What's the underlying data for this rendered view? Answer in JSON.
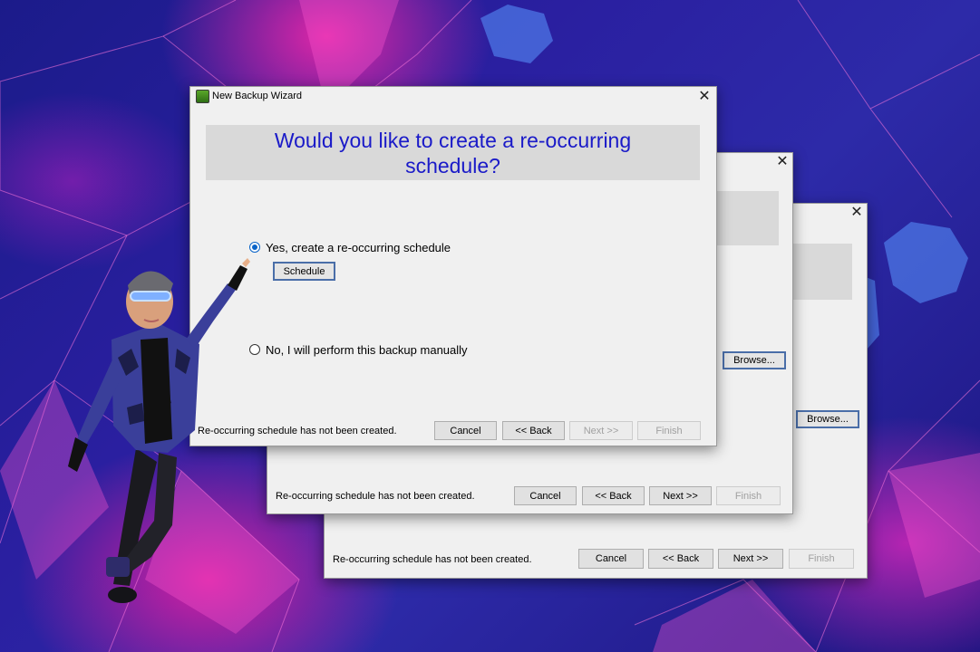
{
  "front": {
    "title": "New Backup Wizard",
    "icon": "backup-app-icon",
    "heading": "Would you like to create a re-occurring schedule?",
    "options": [
      {
        "label": "Yes, create a re-occurring schedule",
        "checked": true
      },
      {
        "label": "No, I will perform this backup manually",
        "checked": false
      }
    ],
    "schedule_button": "Schedule",
    "status": "Re-occurring schedule has not been created.",
    "buttons": {
      "cancel": "Cancel",
      "back": "<< Back",
      "next": "Next >>",
      "finish": "Finish"
    }
  },
  "middle": {
    "browse": "Browse...",
    "status": "Re-occurring schedule has not been created.",
    "buttons": {
      "cancel": "Cancel",
      "back": "<< Back",
      "next": "Next >>",
      "finish": "Finish"
    }
  },
  "back": {
    "browse": "Browse...",
    "status": "Re-occurring schedule has not been created.",
    "buttons": {
      "cancel": "Cancel",
      "back": "<< Back",
      "next": "Next >>",
      "finish": "Finish"
    }
  },
  "colors": {
    "heading": "#1a1ac8",
    "dialog_bg": "#f0f0f0",
    "header_band": "#d9d9d9",
    "radio_accent": "#0a64c8"
  }
}
